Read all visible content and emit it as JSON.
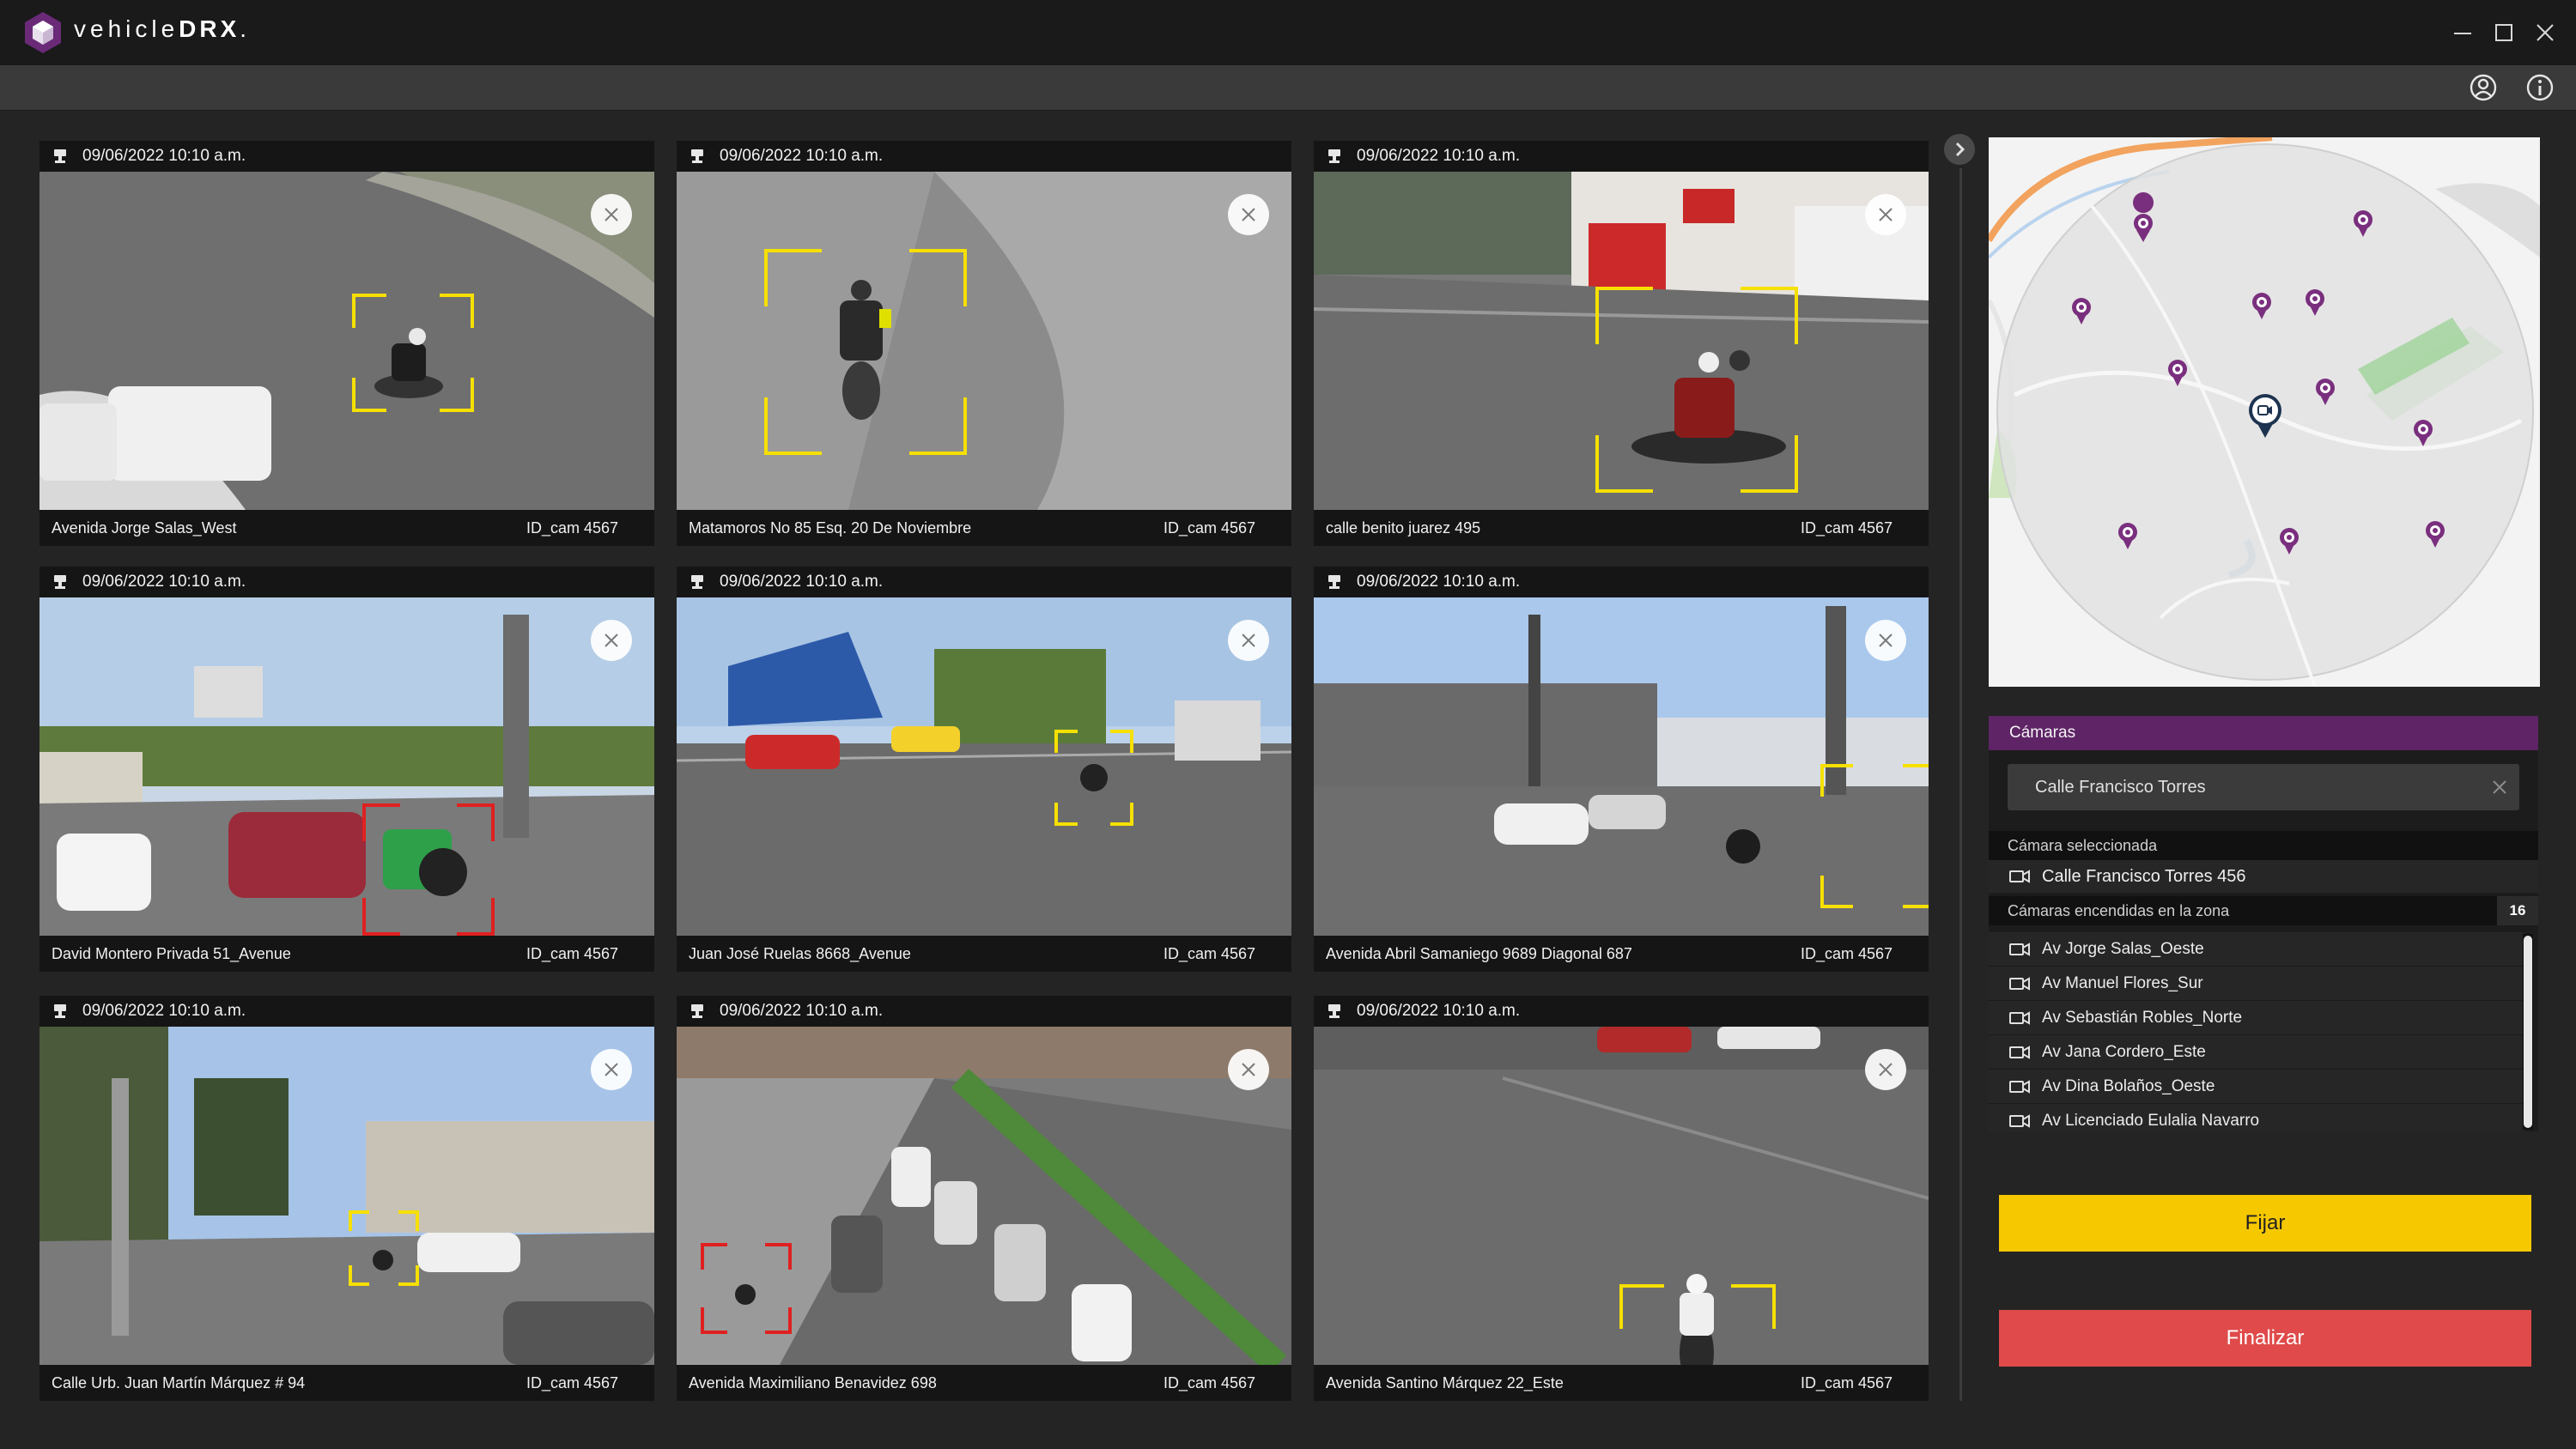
{
  "app": {
    "brand_light": "vehicle",
    "brand_bold": "DRX",
    "brand_suffix": ".",
    "accent": "#5e2466"
  },
  "icons": {
    "logo": "hexagon-cube-icon",
    "minimize": "minimize-icon",
    "maximize": "maximize-icon",
    "close": "close-icon",
    "user": "user-icon",
    "info": "info-icon",
    "camera": "cctv-camera-icon",
    "tile_close": "close-icon",
    "collapse": "chevron-right-icon",
    "list_camera": "video-camera-icon"
  },
  "colors": {
    "detection_yellow": "#f6e000",
    "detection_red": "#e02020",
    "fijar": "#f6c800",
    "finalizar": "#e04a4a"
  },
  "cameras": [
    {
      "timestamp": "09/06/2022 10:10 a.m.",
      "location": "Avenida Jorge Salas_West",
      "id": "ID_cam 4567",
      "detection": "yellow"
    },
    {
      "timestamp": "09/06/2022 10:10 a.m.",
      "location": "Matamoros No 85 Esq. 20 De Noviembre",
      "id": "ID_cam 4567",
      "detection": "yellow"
    },
    {
      "timestamp": "09/06/2022 10:10 a.m.",
      "location": "calle benito juarez 495",
      "id": "ID_cam 4567",
      "detection": "yellow"
    },
    {
      "timestamp": "09/06/2022 10:10 a.m.",
      "location": "David Montero Privada 51_Avenue",
      "id": "ID_cam 4567",
      "detection": "red"
    },
    {
      "timestamp": "09/06/2022 10:10 a.m.",
      "location": "Juan José Ruelas  8668_Avenue",
      "id": "ID_cam 4567",
      "detection": "yellow"
    },
    {
      "timestamp": "09/06/2022 10:10 a.m.",
      "location": "Avenida Abril Samaniego 9689 Diagonal 687",
      "id": "ID_cam 4567",
      "detection": "yellow"
    },
    {
      "timestamp": "09/06/2022 10:10 a.m.",
      "location": "Calle Urb. Juan Martín Márquez # 94",
      "id": "ID_cam 4567",
      "detection": "yellow"
    },
    {
      "timestamp": "09/06/2022 10:10 a.m.",
      "location": "Avenida Maximiliano Benavidez 698",
      "id": "ID_cam 4567",
      "detection": "red"
    },
    {
      "timestamp": "09/06/2022 10:10 a.m.",
      "location": "Avenida Santino Márquez 22_Este",
      "id": "ID_cam 4567",
      "detection": "yellow"
    }
  ],
  "panel": {
    "title": "Cámaras",
    "search_value": "Calle Francisco Torres",
    "selected_label": "Cámara seleccionada",
    "selected_camera": "Calle Francisco Torres 456",
    "zone_label": "Cámaras encendidas en la zona",
    "zone_count": "16",
    "zone_cameras": [
      "Av Jorge Salas_Oeste",
      "Av Manuel Flores_Sur",
      "Av Sebastián Robles_Norte",
      "Av Jana Cordero_Este",
      "Av Dina Bolaños_Oeste",
      "Av Licenciado Eulalia Navarro"
    ]
  },
  "buttons": {
    "fijar": "Fijar",
    "finalizar": "Finalizar"
  }
}
